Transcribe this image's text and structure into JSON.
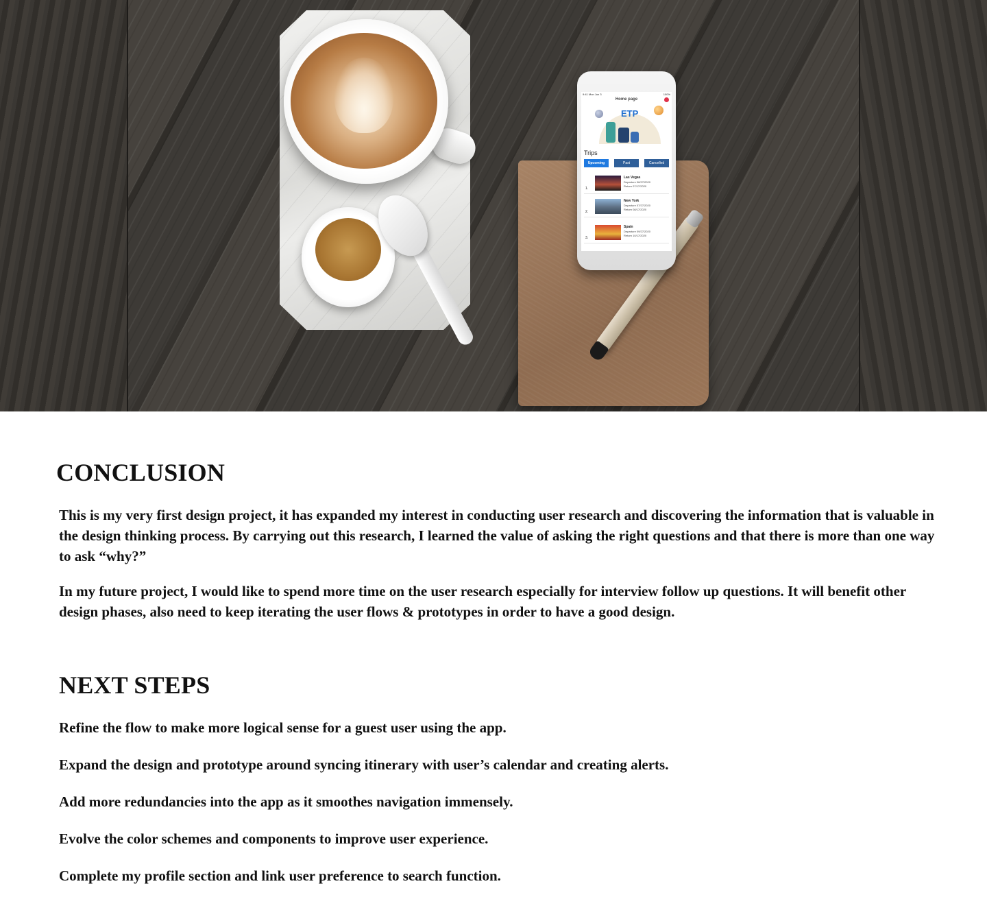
{
  "hero": {
    "phone": {
      "status_time": "9:41 Mon Jun 3",
      "status_battery": "100%",
      "page_title": "Home page",
      "logo": "ETP",
      "section_title": "Trips",
      "tabs": [
        "Upcoming",
        "Past",
        "Cancelled"
      ],
      "trips": [
        {
          "num": "1.",
          "city": "Las Vegas",
          "departure_label": "Departure",
          "departure": "06/27/2020",
          "return_label": "Return",
          "return": "07/17/2020"
        },
        {
          "num": "2.",
          "city": "New York",
          "departure_label": "Departure",
          "departure": "07/27/2020",
          "return_label": "Return",
          "return": "08/17/2020"
        },
        {
          "num": "3.",
          "city": "Spain",
          "departure_label": "Departure",
          "departure": "09/27/2020",
          "return_label": "Return",
          "return": "10/17/2020"
        }
      ]
    }
  },
  "conclusion": {
    "title": "CONCLUSION",
    "paragraphs": [
      "This is my very first design project, it has expanded my interest in conducting user research and discovering the information that is valuable in the design thinking process. By carrying out this research, I learned the value of asking the right questions and that there is more than one way to ask “why?”",
      "In my future project, I would like to spend more time on the user research especially for interview follow up questions. It will benefit other design phases, also need to keep iterating the user flows & prototypes in order to have a good design."
    ]
  },
  "next_steps": {
    "title": "NEXT STEPS",
    "items": [
      "Refine the flow to make more logical sense for a guest user using the app.",
      "Expand the design and prototype around syncing itinerary with user’s calendar and creating alerts.",
      "Add more redundancies into the app as it smoothes navigation immensely.",
      "Evolve the color schemes and components to improve user experience.",
      "Complete my profile section and link user preference to search function."
    ]
  }
}
